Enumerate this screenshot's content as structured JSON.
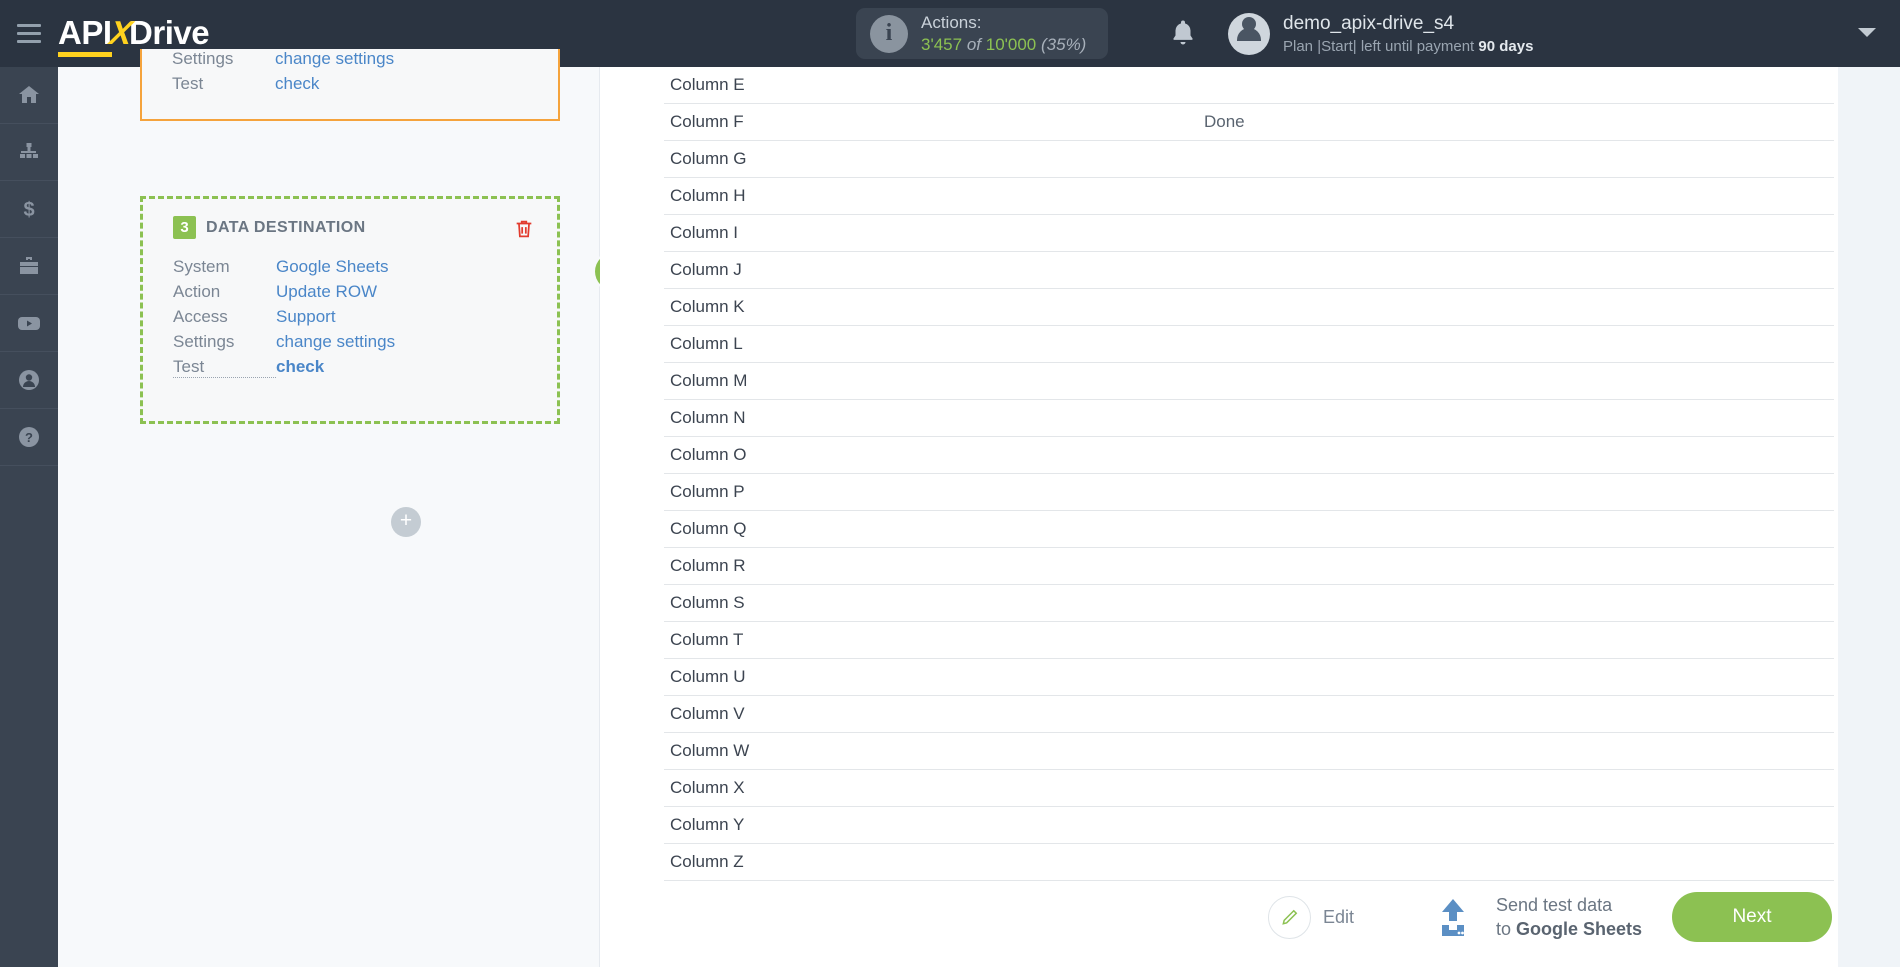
{
  "brand": {
    "name_a": "API",
    "name_x": "X",
    "name_b": "Drive"
  },
  "header": {
    "menu_icon": "hamburger-icon",
    "actions": {
      "label": "Actions:",
      "used": "3'457",
      "of": "of",
      "total": "10'000",
      "percent": "(35%)",
      "info_icon": "info-icon"
    },
    "bell_icon": "bell-icon",
    "user": {
      "name": "demo_apix-drive_s4",
      "plan_prefix": "Plan |Start| left until payment",
      "plan_days": "90 days",
      "avatar_icon": "avatar-icon"
    },
    "caret_icon": "chevron-down-icon"
  },
  "sidebar": {
    "items": [
      {
        "name": "home",
        "icon": "home-icon"
      },
      {
        "name": "connections",
        "icon": "sitemap-icon"
      },
      {
        "name": "billing",
        "icon": "dollar-icon"
      },
      {
        "name": "business",
        "icon": "briefcase-icon"
      },
      {
        "name": "video",
        "icon": "youtube-icon"
      },
      {
        "name": "account",
        "icon": "user-icon"
      },
      {
        "name": "help",
        "icon": "question-icon"
      }
    ]
  },
  "scheme": {
    "card_top": {
      "rows": [
        {
          "key": "Settings",
          "value": "change settings"
        },
        {
          "key": "Test",
          "value": "check"
        }
      ]
    },
    "card_destination": {
      "number": "3",
      "title": "DATA DESTINATION",
      "delete_icon": "trash-icon",
      "status_icon": "check-circle-icon",
      "rows": [
        {
          "key": "System",
          "value": "Google Sheets"
        },
        {
          "key": "Action",
          "value": "Update ROW"
        },
        {
          "key": "Access",
          "value": "Support"
        },
        {
          "key": "Settings",
          "value": "change settings"
        },
        {
          "key": "Test",
          "value": "check"
        }
      ]
    },
    "add_button_label": "+"
  },
  "table": {
    "rows": [
      {
        "name": "Column E",
        "value": ""
      },
      {
        "name": "Column F",
        "value": "Done"
      },
      {
        "name": "Column G",
        "value": ""
      },
      {
        "name": "Column H",
        "value": ""
      },
      {
        "name": "Column I",
        "value": ""
      },
      {
        "name": "Column J",
        "value": ""
      },
      {
        "name": "Column K",
        "value": ""
      },
      {
        "name": "Column L",
        "value": ""
      },
      {
        "name": "Column M",
        "value": ""
      },
      {
        "name": "Column N",
        "value": ""
      },
      {
        "name": "Column O",
        "value": ""
      },
      {
        "name": "Column P",
        "value": ""
      },
      {
        "name": "Column Q",
        "value": ""
      },
      {
        "name": "Column R",
        "value": ""
      },
      {
        "name": "Column S",
        "value": ""
      },
      {
        "name": "Column T",
        "value": ""
      },
      {
        "name": "Column U",
        "value": ""
      },
      {
        "name": "Column V",
        "value": ""
      },
      {
        "name": "Column W",
        "value": ""
      },
      {
        "name": "Column X",
        "value": ""
      },
      {
        "name": "Column Y",
        "value": ""
      },
      {
        "name": "Column Z",
        "value": ""
      }
    ]
  },
  "footer": {
    "edit_label": "Edit",
    "edit_icon": "pencil-icon",
    "send_line1": "Send test data",
    "send_line2_prefix": "to ",
    "send_line2_target": "Google Sheets",
    "upload_icon": "upload-icon",
    "next_label": "Next"
  },
  "colors": {
    "accent_green": "#8cc152",
    "link_blue": "#4a86c8",
    "header_dark": "#2b3441",
    "brand_yellow": "#ffd21e",
    "orange_border": "#f5a33c"
  }
}
